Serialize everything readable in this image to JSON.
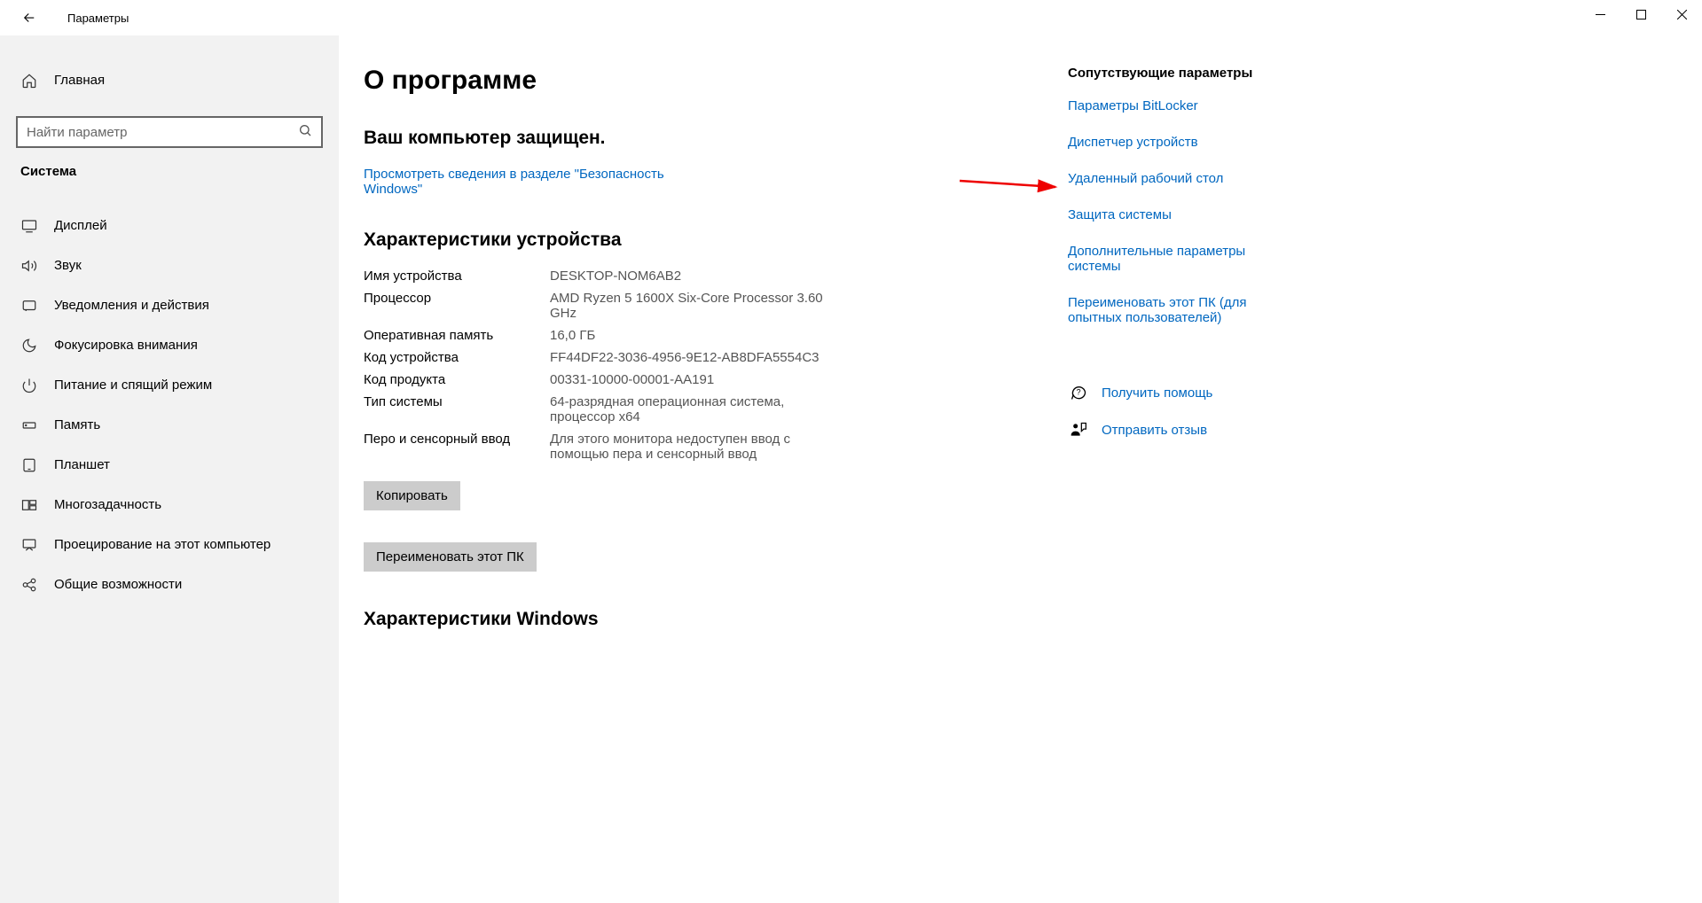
{
  "titlebar": {
    "title": "Параметры"
  },
  "sidebar": {
    "home": "Главная",
    "search_placeholder": "Найти параметр",
    "section": "Система",
    "items": [
      {
        "label": "Дисплей"
      },
      {
        "label": "Звук"
      },
      {
        "label": "Уведомления и действия"
      },
      {
        "label": "Фокусировка внимания"
      },
      {
        "label": "Питание и спящий режим"
      },
      {
        "label": "Память"
      },
      {
        "label": "Планшет"
      },
      {
        "label": "Многозадачность"
      },
      {
        "label": "Проецирование на этот компьютер"
      },
      {
        "label": "Общие возможности"
      }
    ]
  },
  "main": {
    "page_title": "О программе",
    "protected_heading": "Ваш компьютер защищен.",
    "security_link": "Просмотреть сведения в разделе \"Безопасность Windows\"",
    "device_spec_heading": "Характеристики устройства",
    "specs": [
      {
        "key": "Имя устройства",
        "val": "DESKTOP-NOM6AB2"
      },
      {
        "key": "Процессор",
        "val": "AMD Ryzen 5 1600X Six-Core Processor 3.60 GHz"
      },
      {
        "key": "Оперативная память",
        "val": "16,0 ГБ"
      },
      {
        "key": "Код устройства",
        "val": "FF44DF22-3036-4956-9E12-AB8DFA5554C3"
      },
      {
        "key": "Код продукта",
        "val": "00331-10000-00001-AA191"
      },
      {
        "key": "Тип системы",
        "val": "64-разрядная операционная система, процессор x64"
      },
      {
        "key": "Перо и сенсорный ввод",
        "val": "Для этого монитора недоступен ввод с помощью пера и сенсорный ввод"
      }
    ],
    "copy_btn": "Копировать",
    "rename_btn": "Переименовать этот ПК",
    "windows_spec_heading": "Характеристики Windows"
  },
  "related": {
    "heading": "Сопутствующие параметры",
    "links": [
      "Параметры BitLocker",
      "Диспетчер устройств",
      "Удаленный рабочий стол",
      "Защита системы",
      "Дополнительные параметры системы",
      "Переименовать этот ПК (для опытных пользователей)"
    ],
    "help": "Получить помощь",
    "feedback": "Отправить отзыв"
  }
}
